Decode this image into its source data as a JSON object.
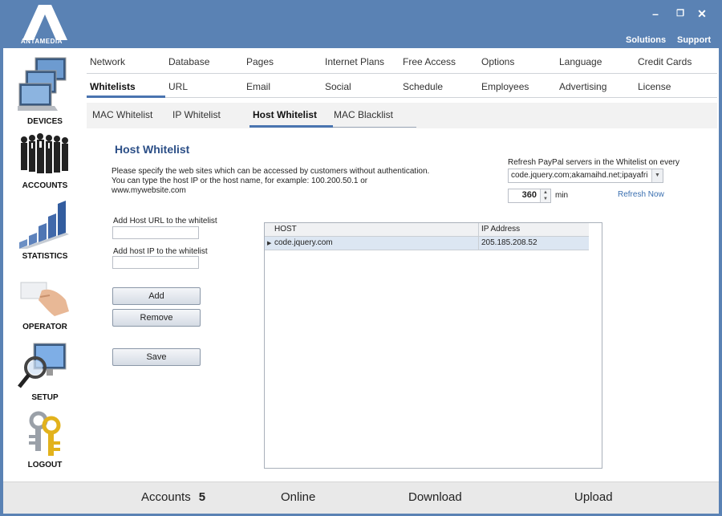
{
  "app": {
    "logo_text": "ANTAMEDIA"
  },
  "window": {
    "minimize": "–",
    "restore": "❐",
    "close": "✕"
  },
  "toplinks": {
    "solutions": "Solutions",
    "support": "Support"
  },
  "sidebar": {
    "items": [
      {
        "label": "DEVICES",
        "icon": "devices-icon"
      },
      {
        "label": "ACCOUNTS",
        "icon": "accounts-icon"
      },
      {
        "label": "STATISTICS",
        "icon": "statistics-icon"
      },
      {
        "label": "OPERATOR",
        "icon": "operator-icon"
      },
      {
        "label": "SETUP",
        "icon": "setup-icon"
      },
      {
        "label": "LOGOUT",
        "icon": "logout-icon"
      }
    ]
  },
  "nav": {
    "row1": [
      "Network",
      "Database",
      "Pages",
      "Internet Plans",
      "Free Access",
      "Options",
      "Language",
      "Credit Cards"
    ],
    "row2": [
      "Whitelists",
      "URL",
      "Email",
      "Social",
      "Schedule",
      "Employees",
      "Advertising",
      "License"
    ],
    "active": "Whitelists"
  },
  "subtabs": {
    "items": [
      "MAC Whitelist",
      "IP Whitelist",
      "Host Whitelist",
      "MAC Blacklist"
    ],
    "active": "Host Whitelist"
  },
  "page": {
    "title": "Host Whitelist",
    "desc1": "Please specify the web sites which can be accessed by customers without authentication.",
    "desc2": "You can type the host IP or the host name, for example:  100.200.50.1  or",
    "desc3": "www.mywebsite.com",
    "url_label": "Add Host URL to the whitelist",
    "url_value": "",
    "ip_label": "Add host IP to the whitelist",
    "ip_value": "",
    "add_btn": "Add",
    "remove_btn": "Remove",
    "save_btn": "Save"
  },
  "paypal": {
    "label": "Refresh PayPal servers in the Whitelist on every",
    "servers": "code.jquery.com;akamaihd.net;ipayafri",
    "interval": "360",
    "unit": "min",
    "refresh": "Refresh Now"
  },
  "grid": {
    "headers": [
      "HOST",
      "IP Address"
    ],
    "rows": [
      {
        "host": "code.jquery.com",
        "ip": "205.185.208.52"
      }
    ]
  },
  "status": {
    "accounts_label": "Accounts",
    "accounts_value": "5",
    "online": "Online",
    "download": "Download",
    "upload": "Upload"
  },
  "colors": {
    "brand": "#5a82b4",
    "title": "#2c4f87",
    "link": "#3a6fb0",
    "row_selected": "#dce6f2"
  }
}
